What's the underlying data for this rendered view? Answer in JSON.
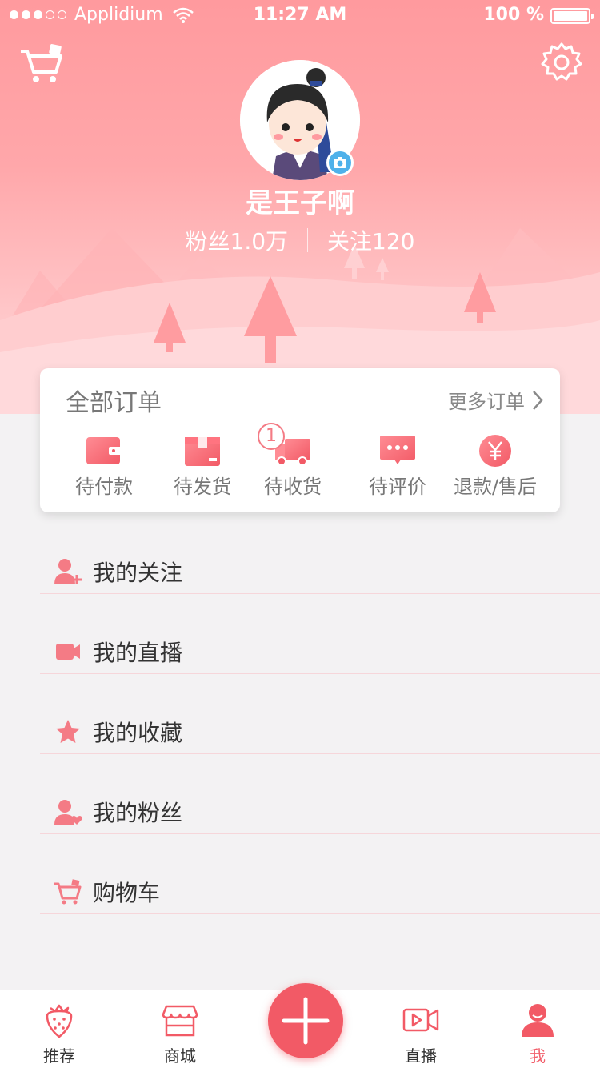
{
  "status_bar": {
    "carrier": "Applidium",
    "time": "11:27 AM",
    "battery": "100 %"
  },
  "profile": {
    "username": "是王子啊",
    "fans": "粉丝1.0万",
    "following": "关注120"
  },
  "orders": {
    "title": "全部订单",
    "more": "更多订单",
    "items": [
      {
        "label": "待付款",
        "icon": "wallet-icon"
      },
      {
        "label": "待发货",
        "icon": "package-icon"
      },
      {
        "label": "待收货",
        "icon": "truck-icon",
        "badge": "1"
      },
      {
        "label": "待评价",
        "icon": "comment-icon"
      },
      {
        "label": "退款/售后",
        "icon": "yen-icon"
      }
    ]
  },
  "menu": [
    {
      "label": "我的关注",
      "icon": "user-add-icon"
    },
    {
      "label": "我的直播",
      "icon": "video-camera-icon"
    },
    {
      "label": "我的收藏",
      "icon": "star-icon"
    },
    {
      "label": "我的粉丝",
      "icon": "user-heart-icon"
    },
    {
      "label": "购物车",
      "icon": "cart-icon"
    }
  ],
  "tabbar": [
    {
      "label": "推荐",
      "icon": "strawberry-icon"
    },
    {
      "label": "商城",
      "icon": "shop-icon"
    },
    {
      "label": "",
      "icon": "plus-icon"
    },
    {
      "label": "直播",
      "icon": "live-video-icon"
    },
    {
      "label": "我",
      "icon": "person-icon",
      "active": true
    }
  ],
  "colors": {
    "accent": "#f25a66",
    "header_top": "#ff9a9e",
    "header_bottom": "#ffd6d8",
    "badge_blue": "#4fb1ea"
  }
}
